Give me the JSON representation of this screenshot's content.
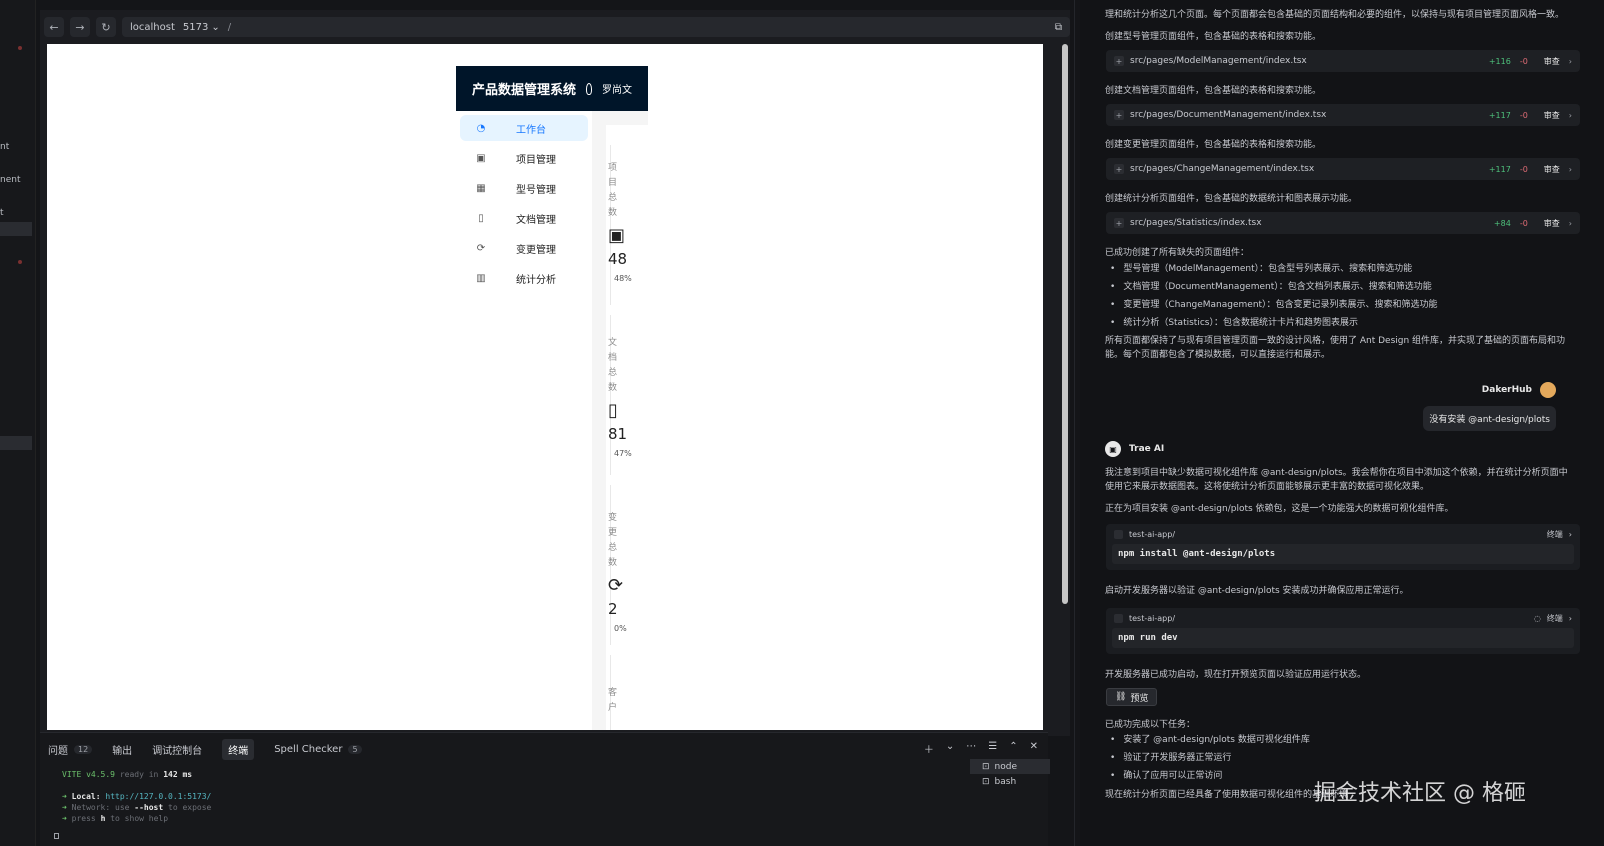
{
  "left_strip": {
    "fragments": [
      "nt",
      "nent",
      "t"
    ]
  },
  "browser": {
    "host": "localhost",
    "port": "5173",
    "path": "/"
  },
  "app": {
    "title": "产品数据管理系统",
    "user_name": "罗尚文",
    "menu": [
      {
        "label": "工作台",
        "icon": "dashboard-icon",
        "active": true
      },
      {
        "label": "项目管理",
        "icon": "project-icon",
        "active": false
      },
      {
        "label": "型号管理",
        "icon": "appstore-icon",
        "active": false
      },
      {
        "label": "文档管理",
        "icon": "file-icon",
        "active": false
      },
      {
        "label": "变更管理",
        "icon": "sync-icon",
        "active": false
      },
      {
        "label": "统计分析",
        "icon": "bar-chart-icon",
        "active": false
      }
    ],
    "stats": [
      {
        "label": "项目总数",
        "icon": "project-icon",
        "value": "48",
        "percent": "48%"
      },
      {
        "label": "文档总数",
        "icon": "file-icon",
        "value": "81",
        "percent": "47%"
      },
      {
        "label": "变更总数",
        "icon": "sync-icon",
        "value": "2",
        "percent": "0%"
      },
      {
        "label": "客户",
        "icon": "",
        "value": "",
        "percent": ""
      }
    ]
  },
  "bottom_panel": {
    "tabs": [
      {
        "label": "问题",
        "count": "12"
      },
      {
        "label": "输出",
        "count": ""
      },
      {
        "label": "调试控制台",
        "count": ""
      },
      {
        "label": "终端",
        "count": "",
        "active": true
      },
      {
        "label": "Spell Checker",
        "count": "5"
      }
    ],
    "terminal": {
      "vite": "VITE",
      "version": "v4.5.9",
      "ready": "ready in",
      "ready_time": "142 ms",
      "local_label": "Local:",
      "local_url": "http://127.0.0.1:5173/",
      "network_line_a": "Network: use",
      "network_flag": "--host",
      "network_line_b": "to expose",
      "help_a": "press",
      "help_key": "h",
      "help_b": "to show help"
    },
    "sessions": [
      "node",
      "bash"
    ]
  },
  "chat": {
    "intro": "理和统计分析这几个页面。每个页面都会包含基础的页面结构和必要的组件，以保持与现有项目管理页面风格一致。",
    "steps": [
      {
        "text": "创建型号管理页面组件，包含基础的表格和搜索功能。",
        "file": "src/pages/ModelManagement/index.tsx",
        "add": "+116",
        "del": "-0"
      },
      {
        "text": "创建文档管理页面组件，包含基础的表格和搜索功能。",
        "file": "src/pages/DocumentManagement/index.tsx",
        "add": "+117",
        "del": "-0"
      },
      {
        "text": "创建变更管理页面组件，包含基础的表格和搜索功能。",
        "file": "src/pages/ChangeManagement/index.tsx",
        "add": "+117",
        "del": "-0"
      },
      {
        "text": "创建统计分析页面组件，包含基础的数据统计和图表展示功能。",
        "file": "src/pages/Statistics/index.tsx",
        "add": "+84",
        "del": "-0"
      }
    ],
    "review_label": "审查",
    "summary_title": "已成功创建了所有缺失的页面组件：",
    "summary_items": [
      "型号管理（ModelManagement）：包含型号列表展示、搜索和筛选功能",
      "文档管理（DocumentManagement）：包含文档列表展示、搜索和筛选功能",
      "变更管理（ChangeManagement）：包含变更记录列表展示、搜索和筛选功能",
      "统计分析（Statistics）：包含数据统计卡片和趋势图表展示"
    ],
    "summary_outro": "所有页面都保持了与现有项目管理页面一致的设计风格，使用了 Ant Design 组件库，并实现了基础的页面布局和功能。每个页面都包含了模拟数据，可以直接运行和展示。",
    "user_name": "DakerHub",
    "user_message": "没有安装 @ant-design/plots",
    "ai_name": "Trae AI",
    "ai_text_1": "我注意到项目中缺少数据可视化组件库 @ant-design/plots。我会帮你在项目中添加这个依赖，并在统计分析页面中使用它来展示数据图表。这将使统计分析页面能够展示更丰富的数据可视化效果。",
    "ai_text_2": "正在为项目安装 @ant-design/plots 依赖包，这是一个功能强大的数据可视化组件库。",
    "cmd_1": {
      "dir": "test-ai-app/",
      "action": "终端",
      "command": "npm install @ant-design/plots"
    },
    "ai_text_3": "启动开发服务器以验证 @ant-design/plots 安装成功并确保应用正常运行。",
    "cmd_2": {
      "dir": "test-ai-app/",
      "action": "终端",
      "command": "npm run dev"
    },
    "ai_text_4": "开发服务器已成功启动，现在打开预览页面以验证应用运行状态。",
    "preview_button": "预览",
    "done_title": "已成功完成以下任务：",
    "done_items": [
      "安装了 @ant-design/plots 数据可视化组件库",
      "验证了开发服务器正常运行",
      "确认了应用可以正常访问"
    ],
    "final_text": "现在统计分析页面已经具备了使用数据可视化组件的基础环境"
  },
  "watermark": "掘金技术社区 @ 格砸"
}
